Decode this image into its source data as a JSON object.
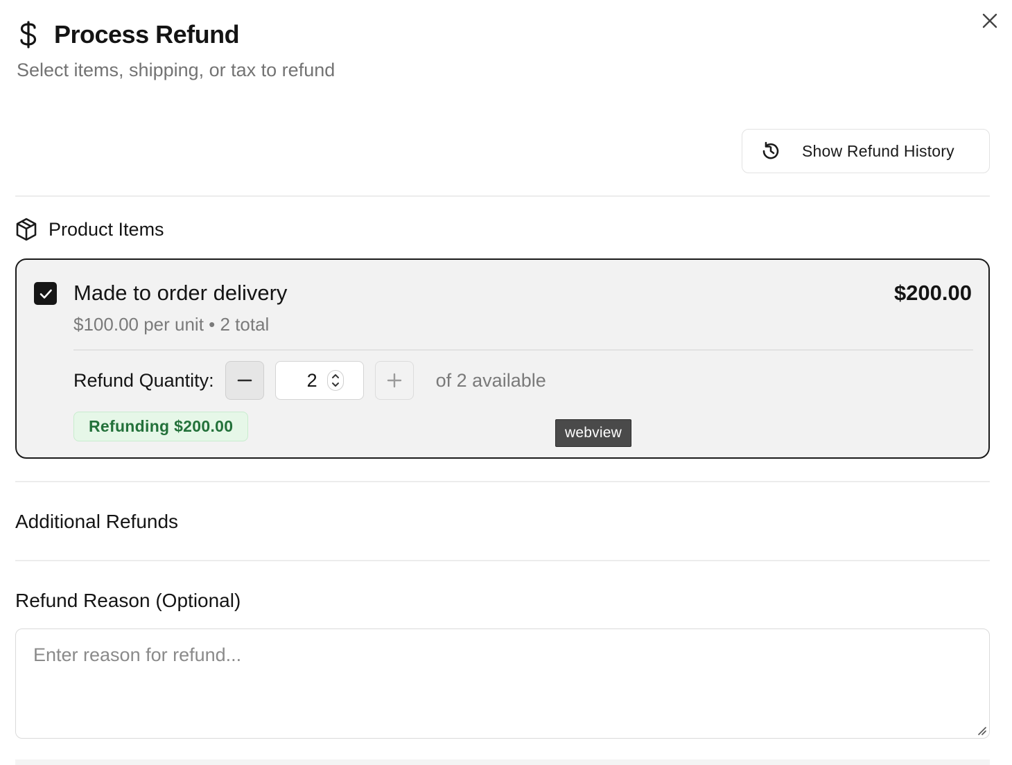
{
  "dialog": {
    "title": "Process Refund",
    "subtitle": "Select items, shipping, or tax to refund",
    "title_icon": "dollar-sign-icon",
    "close_icon": "close-icon"
  },
  "history_button": {
    "label": "Show Refund History",
    "icon": "history-icon"
  },
  "product_section": {
    "title": "Product Items",
    "icon": "package-icon"
  },
  "items": [
    {
      "name": "Made to order delivery",
      "total": "$200.00",
      "meta": "$100.00 per unit • 2 total",
      "selected": true,
      "refund_quantity_label": "Refund Quantity:",
      "quantity": "2",
      "available_text": "of 2 available",
      "refund_badge": "Refunding $200.00"
    }
  ],
  "tooltip": "webview",
  "additional_section": {
    "title": "Additional Refunds"
  },
  "reason": {
    "title": "Refund Reason (Optional)",
    "placeholder": "Enter reason for refund...",
    "value": ""
  },
  "colors": {
    "primary_dark": "#161616",
    "success_text": "#23713a",
    "success_bg": "#e6f7e8",
    "card_bg": "#f2f2f2",
    "muted_text": "#7a7a7a"
  }
}
